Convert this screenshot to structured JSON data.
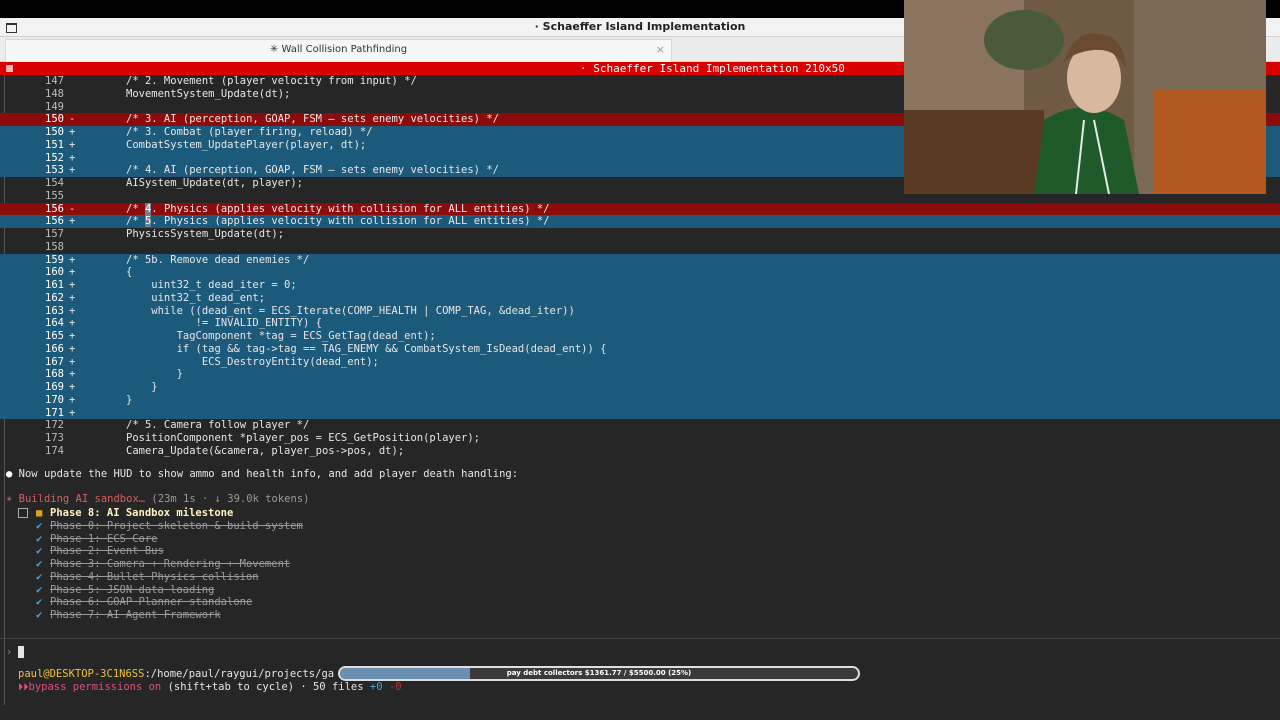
{
  "window": {
    "title": "· Schaeffer Island Implementation"
  },
  "tab": {
    "title": "✳ Wall Collision Pathfinding",
    "close": "×"
  },
  "terminal": {
    "header_title": "· Schaeffer Island Implementation 210x50"
  },
  "diff": [
    {
      "ln": "147",
      "mark": "",
      "type": "ctx",
      "code": "/* 2. Movement (player velocity from input) */"
    },
    {
      "ln": "148",
      "mark": "",
      "type": "ctx",
      "code": "MovementSystem_Update(dt);"
    },
    {
      "ln": "149",
      "mark": "",
      "type": "ctx",
      "code": ""
    },
    {
      "ln": "150",
      "mark": "-",
      "type": "del",
      "code": "/* 3. AI (perception, GOAP, FSM — sets enemy velocities) */"
    },
    {
      "ln": "150",
      "mark": "+",
      "type": "add",
      "code": "/* 3. Combat (player firing, reload) */"
    },
    {
      "ln": "151",
      "mark": "+",
      "type": "add",
      "code": "CombatSystem_UpdatePlayer(player, dt);"
    },
    {
      "ln": "152",
      "mark": "+",
      "type": "add",
      "code": ""
    },
    {
      "ln": "153",
      "mark": "+",
      "type": "add",
      "code": "/* 4. AI (perception, GOAP, FSM — sets enemy velocities) */"
    },
    {
      "ln": "154",
      "mark": "",
      "type": "ctx",
      "code": "AISystem_Update(dt, player);"
    },
    {
      "ln": "155",
      "mark": "",
      "type": "ctx",
      "code": ""
    },
    {
      "ln": "156",
      "mark": "-",
      "type": "del",
      "code": "/* 4. Physics (applies velocity with collision for ALL entities) */",
      "hl": "4"
    },
    {
      "ln": "156",
      "mark": "+",
      "type": "add",
      "code": "/* 5. Physics (applies velocity with collision for ALL entities) */",
      "hl": "5"
    },
    {
      "ln": "157",
      "mark": "",
      "type": "ctx",
      "code": "PhysicsSystem_Update(dt);"
    },
    {
      "ln": "158",
      "mark": "",
      "type": "ctx",
      "code": ""
    },
    {
      "ln": "159",
      "mark": "+",
      "type": "add",
      "code": "/* 5b. Remove dead enemies */"
    },
    {
      "ln": "160",
      "mark": "+",
      "type": "add",
      "code": "{"
    },
    {
      "ln": "161",
      "mark": "+",
      "type": "add",
      "code": "    uint32_t dead_iter = 0;"
    },
    {
      "ln": "162",
      "mark": "+",
      "type": "add",
      "code": "    uint32_t dead_ent;"
    },
    {
      "ln": "163",
      "mark": "+",
      "type": "add",
      "code": "    while ((dead_ent = ECS_Iterate(COMP_HEALTH | COMP_TAG, &dead_iter))"
    },
    {
      "ln": "164",
      "mark": "+",
      "type": "add",
      "code": "           != INVALID_ENTITY) {"
    },
    {
      "ln": "165",
      "mark": "+",
      "type": "add",
      "code": "        TagComponent *tag = ECS_GetTag(dead_ent);"
    },
    {
      "ln": "166",
      "mark": "+",
      "type": "add",
      "code": "        if (tag && tag->tag == TAG_ENEMY && CombatSystem_IsDead(dead_ent)) {"
    },
    {
      "ln": "167",
      "mark": "+",
      "type": "add",
      "code": "            ECS_DestroyEntity(dead_ent);"
    },
    {
      "ln": "168",
      "mark": "+",
      "type": "add",
      "code": "        }"
    },
    {
      "ln": "169",
      "mark": "+",
      "type": "add",
      "code": "    }"
    },
    {
      "ln": "170",
      "mark": "+",
      "type": "add",
      "code": "}"
    },
    {
      "ln": "171",
      "mark": "+",
      "type": "add",
      "code": ""
    },
    {
      "ln": "172",
      "mark": "",
      "type": "ctx",
      "code": "/* 5. Camera follow player */"
    },
    {
      "ln": "173",
      "mark": "",
      "type": "ctx",
      "code": "PositionComponent *player_pos = ECS_GetPosition(player);"
    },
    {
      "ln": "174",
      "mark": "",
      "type": "ctx",
      "code": "Camera_Update(&camera, player_pos->pos, dt);"
    }
  ],
  "message": {
    "bullet": "●",
    "text": "Now update the HUD to show ammo and health info, and add player death handling:"
  },
  "status": {
    "spinner": "✶",
    "label": "Building AI sandbox…",
    "meta": "(23m 1s · ↓ 39.0k tokens)"
  },
  "phases": [
    {
      "icon": "■",
      "text": "Phase 8: AI Sandbox milestone",
      "current": true
    },
    {
      "icon": "✔",
      "text": "Phase 0: Project skeleton & build system",
      "current": false
    },
    {
      "icon": "✔",
      "text": "Phase 1: ECS Core",
      "current": false
    },
    {
      "icon": "✔",
      "text": "Phase 2: Event Bus",
      "current": false
    },
    {
      "icon": "✔",
      "text": "Phase 3: Camera + Rendering + Movement",
      "current": false
    },
    {
      "icon": "✔",
      "text": "Phase 4: Bullet Physics collision",
      "current": false
    },
    {
      "icon": "✔",
      "text": "Phase 5: JSON data loading",
      "current": false
    },
    {
      "icon": "✔",
      "text": "Phase 6: GOAP Planner standalone",
      "current": false
    },
    {
      "icon": "✔",
      "text": "Phase 7: AI Agent Framework",
      "current": false
    }
  ],
  "prompt": {
    "symbol": "›"
  },
  "footer": {
    "user": "paul@DESKTOP-3C1N6SS",
    "path": ":/home/paul/raygui/projects/ga",
    "perm_icon": "⏵⏵",
    "perm_label": "bypass permissions on",
    "perm_hint": " (shift+tab to cycle) · 50 files ",
    "added": "+0",
    "removed": " -0"
  },
  "overlay": {
    "progress_text": "pay debt collectors $1361.77 / $5500.00 (25%)",
    "progress_fraction": 0.25
  }
}
